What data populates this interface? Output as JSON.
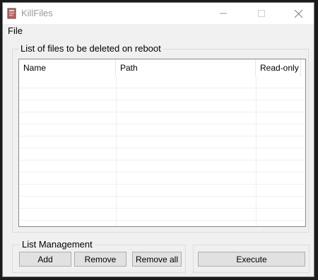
{
  "window": {
    "title": "KillFiles",
    "icon": "document-icon"
  },
  "menu": {
    "file": "File"
  },
  "files_group": {
    "label": "List of files to be deleted on reboot",
    "columns": [
      "Name",
      "Path",
      "Read-only"
    ],
    "rows": []
  },
  "management_group": {
    "label": "List Management",
    "add": "Add",
    "remove": "Remove",
    "remove_all": "Remove all"
  },
  "execute_group": {
    "execute": "Execute"
  }
}
